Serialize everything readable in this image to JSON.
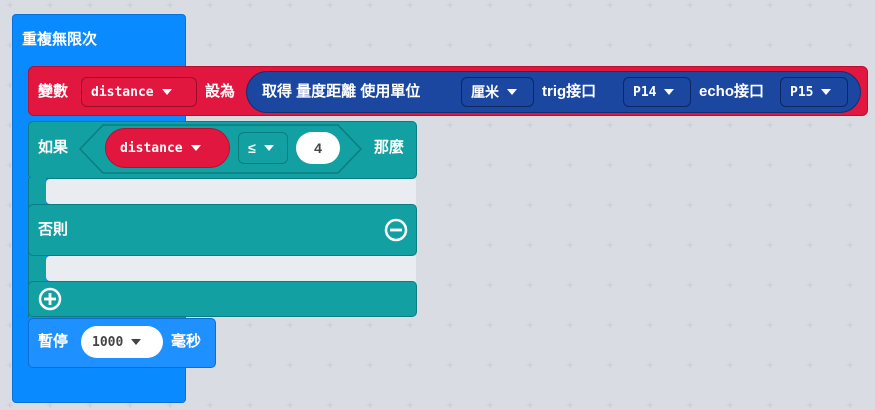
{
  "loop": {
    "label": "重複無限次",
    "color": "#0078d7"
  },
  "set_var": {
    "label": "變數",
    "var_name": "distance",
    "to_label": "設為",
    "color": "#dc143c"
  },
  "sonar": {
    "get_label": "取得 量度距離 使用單位",
    "unit": "厘米",
    "trig_label": "trig接口",
    "trig_pin": "P14",
    "echo_label": "echo接口",
    "echo_pin": "P15",
    "color": "#1a4da0"
  },
  "if_block": {
    "if_label": "如果",
    "var_name": "distance",
    "operator": "≤",
    "value": "4",
    "then_label": "那麼",
    "else_label": "否則",
    "color": "#0b9c9f"
  },
  "pause": {
    "label": "暫停",
    "value": "1000",
    "unit": "毫秒",
    "color": "#1e90ff"
  },
  "icons": {
    "remove": "minus-circle-icon",
    "add": "plus-circle-icon",
    "dropdown": "triangle-down"
  }
}
